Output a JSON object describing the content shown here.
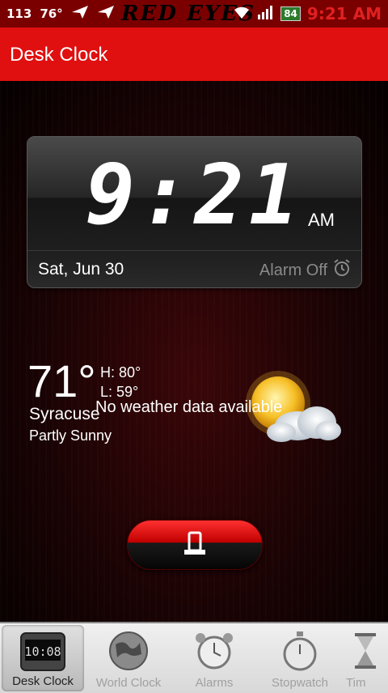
{
  "status_bar": {
    "left_text": "113",
    "weather_temp": "76°",
    "carrier_text": "RED EYES",
    "battery": "84",
    "time": "9:21 AM"
  },
  "action_bar": {
    "title": "Desk Clock"
  },
  "clock": {
    "time": "9:21",
    "ampm": "AM",
    "date": "Sat, Jun 30",
    "alarm_status": "Alarm Off"
  },
  "weather": {
    "temperature": "71°",
    "high": "H:  80°",
    "low": "L:   59°",
    "city": "Syracuse",
    "condition": "Partly Sunny",
    "message": "No weather data available",
    "icon": "partly-sunny-icon"
  },
  "dock_button": {
    "icon": "dock-icon"
  },
  "tabs": [
    {
      "label": "Desk Clock",
      "icon": "desk-clock-icon",
      "icon_text": "10:08",
      "active": true
    },
    {
      "label": "World Clock",
      "icon": "globe-icon",
      "active": false
    },
    {
      "label": "Alarms",
      "icon": "alarm-clock-icon",
      "active": false
    },
    {
      "label": "Stopwatch",
      "icon": "stopwatch-icon",
      "active": false
    },
    {
      "label": "Tim",
      "icon": "hourglass-icon",
      "active": false
    }
  ],
  "colors": {
    "accent": "#e01010",
    "status_bar": "#7a0000"
  }
}
